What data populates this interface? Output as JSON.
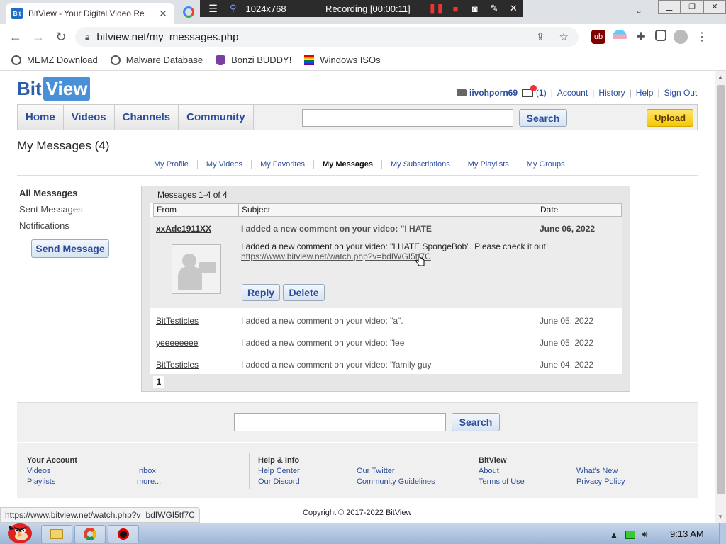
{
  "browser": {
    "tab_title": "BitView - Your Digital Video Re",
    "tab_favicon_text": "Bit",
    "url": "bitview.net/my_messages.php",
    "recording": {
      "size": "1024x768",
      "status": "Recording [00:00:11]"
    },
    "bookmarks": [
      {
        "label": "MEMZ Download",
        "icon": "globe-icon"
      },
      {
        "label": "Malware Database",
        "icon": "globe-icon"
      },
      {
        "label": "Bonzi BUDDY!",
        "icon": "bonzi-icon"
      },
      {
        "label": "Windows ISOs",
        "icon": "rainbow-flag-icon"
      }
    ],
    "status_url": "https://www.bitview.net/watch.php?v=bdIWGI5tf7C"
  },
  "site": {
    "logo_bit": "Bit",
    "logo_view": "View",
    "user": {
      "username": "iivohporn69",
      "mail_count_open": "(",
      "mail_count": "1",
      "mail_count_close": ")",
      "links": [
        "Account",
        "History",
        "Help",
        "Sign Out"
      ]
    },
    "nav": {
      "tabs": [
        "Home",
        "Videos",
        "Channels",
        "Community"
      ],
      "search_button": "Search",
      "upload_button": "Upload"
    },
    "page_title": "My Messages (4)",
    "subnav": [
      {
        "label": "My Profile",
        "active": false
      },
      {
        "label": "My Videos",
        "active": false
      },
      {
        "label": "My Favorites",
        "active": false
      },
      {
        "label": "My Messages",
        "active": true
      },
      {
        "label": "My Subscriptions",
        "active": false
      },
      {
        "label": "My Playlists",
        "active": false
      },
      {
        "label": "My Groups",
        "active": false
      }
    ],
    "leftnav": {
      "items": [
        "All Messages",
        "Sent Messages",
        "Notifications"
      ],
      "send_button": "Send Message"
    },
    "messages": {
      "count_label": "Messages 1-4 of 4",
      "columns": [
        "From",
        "Subject",
        "Date"
      ],
      "open": {
        "from": "xxAde1911XX",
        "subject": "I added a new comment on your video: \"I HATE",
        "date": "June 06, 2022",
        "body": "I added a new comment on your video: \"I HATE SpongeBob\". Please check it out!",
        "link": "https://www.bitview.net/watch.php?v=bdIWGI5tf7C",
        "reply_button": "Reply",
        "delete_button": "Delete"
      },
      "rows": [
        {
          "from": "BitTesticles",
          "subject": "I added a new comment on your video: \"a\".",
          "date": "June 05, 2022"
        },
        {
          "from": "yeeeeeeee",
          "subject": "I added a new comment on your video: \"lee",
          "date": "June 05, 2022"
        },
        {
          "from": "BitTesticles",
          "subject": "I added a new comment on your video: \"family guy",
          "date": "June 04, 2022"
        }
      ],
      "page": "1"
    },
    "footer": {
      "search_button": "Search",
      "columns": [
        {
          "heading": "Your Account",
          "links": [
            "Videos",
            "Playlists",
            "Inbox",
            "more..."
          ]
        },
        {
          "heading": "Help & Info",
          "links": [
            "Help Center",
            "Our Discord",
            "Our Twitter",
            "Community Guidelines"
          ]
        },
        {
          "heading": "BitView",
          "links": [
            "About",
            "Terms of Use",
            "What's New",
            "Privacy Policy"
          ]
        }
      ],
      "copyright": "Copyright © 2017-2022 BitView"
    }
  },
  "taskbar": {
    "clock": "9:13 AM"
  },
  "colors": {
    "link": "#2b4c9a",
    "upload": "#f6c800",
    "logo_blue": "#4a90d9"
  }
}
